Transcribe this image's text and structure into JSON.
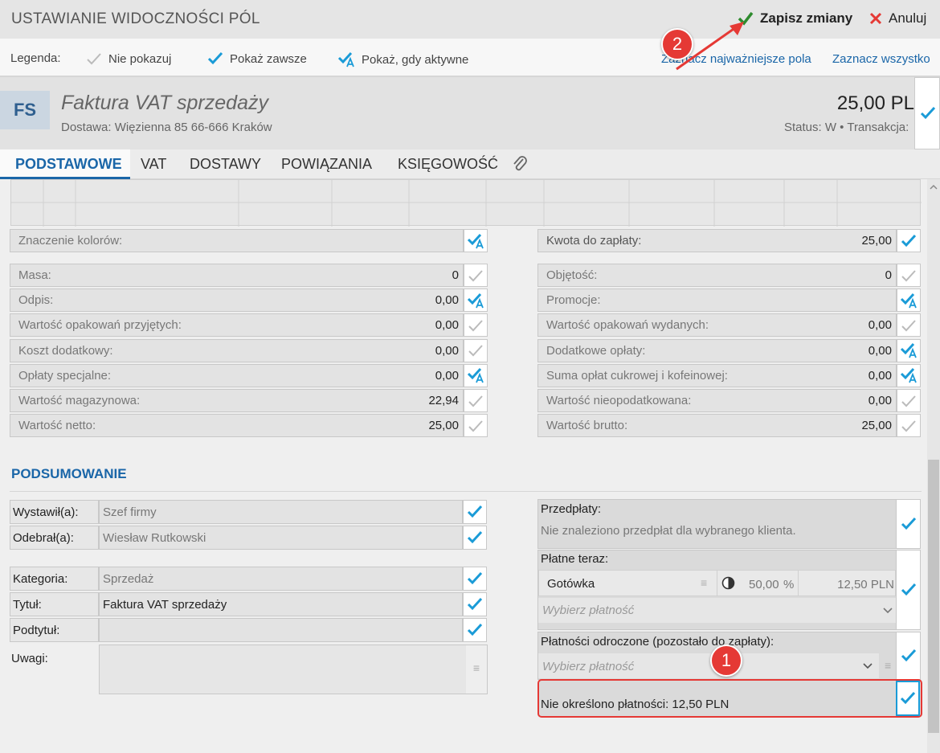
{
  "header": {
    "title": "USTAWIANIE WIDOCZNOŚCI PÓL",
    "save_label": "Zapisz zmiany",
    "cancel_label": "Anuluj"
  },
  "legend": {
    "label": "Legenda:",
    "items": [
      "Nie pokazuj",
      "Pokaż zawsze",
      "Pokaż, gdy aktywne"
    ],
    "link_important": "Zaznacz najważniejsze pola",
    "link_all": "Zaznacz wszystko"
  },
  "document": {
    "badge": "FS",
    "title": "Faktura VAT sprzedaży",
    "address": "Dostawa: Więzienna  85  66-666 Kraków",
    "amount": "25,00 PL",
    "status": "Status: W  •  Transakcja:"
  },
  "tabs": [
    "PODSTAWOWE",
    "VAT",
    "DOSTAWY",
    "POWIĄZANIA",
    "KSIĘGOWOŚĆ"
  ],
  "left_fields": [
    {
      "label": "Masa:",
      "value": "0",
      "mode": "hide"
    },
    {
      "label": "Odpis:",
      "value": "0,00",
      "mode": "active"
    },
    {
      "label": "Wartość opakowań przyjętych:",
      "value": "0,00",
      "mode": "hide"
    },
    {
      "label": "Koszt dodatkowy:",
      "value": "0,00",
      "mode": "hide"
    },
    {
      "label": "Opłaty specjalne:",
      "value": "0,00",
      "mode": "active"
    },
    {
      "label": "Wartość magazynowa:",
      "value": "22,94",
      "mode": "hide"
    },
    {
      "label": "Wartość netto:",
      "value": "25,00",
      "mode": "hide"
    }
  ],
  "right_fields": [
    {
      "label": "Objętość:",
      "value": "0",
      "mode": "hide"
    },
    {
      "label": "Promocje:",
      "value": "",
      "mode": "active"
    },
    {
      "label": "Wartość opakowań wydanych:",
      "value": "0,00",
      "mode": "hide"
    },
    {
      "label": "Dodatkowe opłaty:",
      "value": "0,00",
      "mode": "active"
    },
    {
      "label": "Suma opłat cukrowej i kofeinowej:",
      "value": "0,00",
      "mode": "active"
    },
    {
      "label": "Wartość nieopodatkowana:",
      "value": "0,00",
      "mode": "hide"
    },
    {
      "label": "Wartość brutto:",
      "value": "25,00",
      "mode": "hide"
    }
  ],
  "colors_field": {
    "label": "Znaczenie kolorów:"
  },
  "due_field": {
    "label": "Kwota do zapłaty:",
    "value": "25,00"
  },
  "summary": {
    "title": "PODSUMOWANIE",
    "issued_label": "Wystawił(a):",
    "issued_value": "Szef firmy",
    "received_label": "Odebrał(a):",
    "received_value": "Wiesław Rutkowski",
    "category_label": "Kategoria:",
    "category_value": "Sprzedaż",
    "title_label": "Tytuł:",
    "title_value": "Faktura VAT sprzedaży",
    "subtitle_label": "Podtytuł:",
    "subtitle_value": "",
    "notes_label": "Uwagi:"
  },
  "payments": {
    "prepay_label": "Przedpłaty:",
    "prepay_text": "Nie znaleziono przedpłat dla wybranego klienta.",
    "paynow_label": "Płatne teraz:",
    "method": "Gotówka",
    "percent": "50,00",
    "percent_unit": "%",
    "amount": "12,50 PLN",
    "select_placeholder": "Wybierz płatność",
    "deferred_label": "Płatności odroczone (pozostało do zapłaty):",
    "undefined_text": "Nie określono płatności: 12,50 PLN"
  },
  "annotations": {
    "badge1": "1",
    "badge2": "2"
  },
  "colors": {
    "accent": "#1a9bd7",
    "link": "#1a66a8",
    "highlight": "#e53935",
    "save_check": "#2e8b2e"
  }
}
